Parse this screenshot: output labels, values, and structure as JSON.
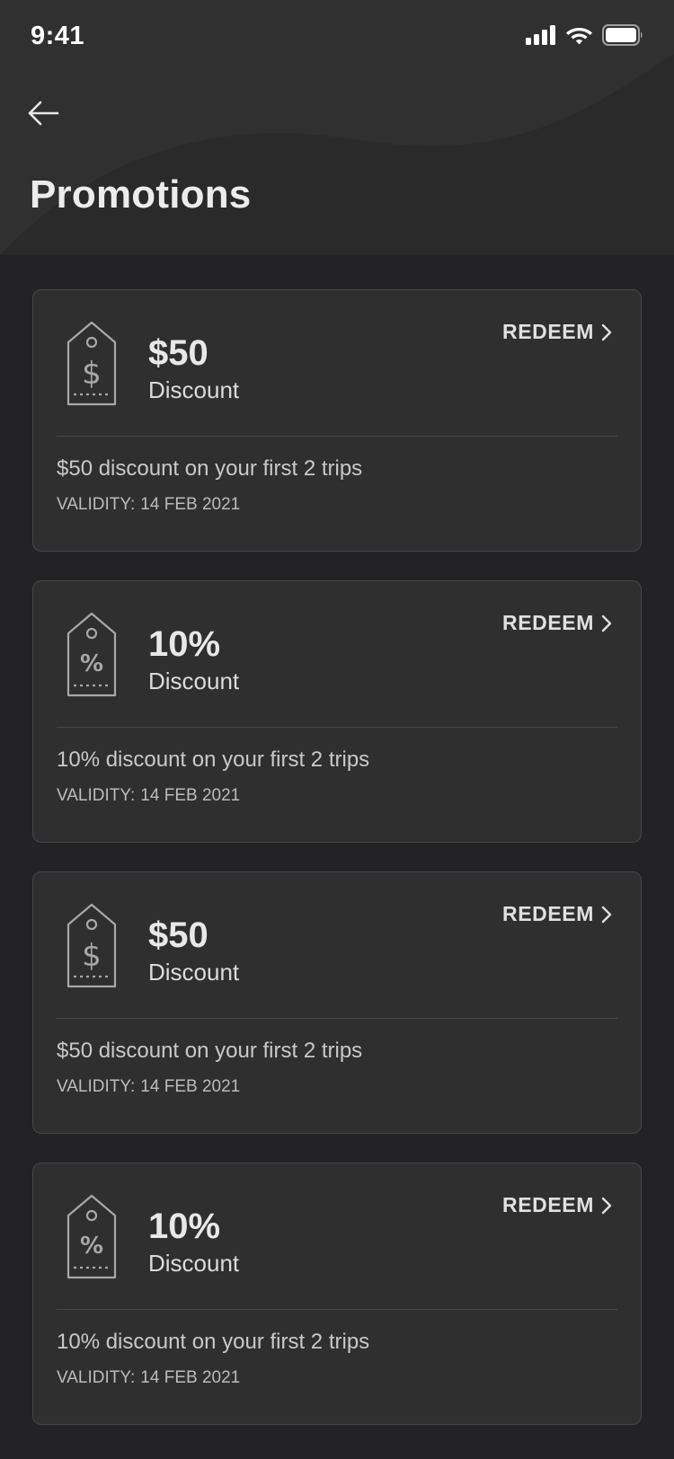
{
  "status_bar": {
    "time": "9:41",
    "icons": [
      "cellular-signal-icon",
      "wifi-icon",
      "battery-icon"
    ]
  },
  "header": {
    "back_icon": "arrow-left-icon",
    "title": "Promotions"
  },
  "colors": {
    "background": "#232325",
    "header": "#2c2c2d",
    "card": "#2f2f30",
    "card_border": "#474749",
    "text": "#e6e6e6"
  },
  "promotions": [
    {
      "icon": "price-tag-dollar-icon",
      "amount": "$50",
      "type": "Discount",
      "action": "REDEEM",
      "description": "$50 discount on your first 2 trips",
      "validity_label": "VALIDITY:",
      "validity_date": "14 FEB 2021"
    },
    {
      "icon": "price-tag-percent-icon",
      "amount": "10%",
      "type": "Discount",
      "action": "REDEEM",
      "description": "10% discount on your first 2 trips",
      "validity_label": "VALIDITY:",
      "validity_date": "14 FEB 2021"
    },
    {
      "icon": "price-tag-dollar-icon",
      "amount": "$50",
      "type": "Discount",
      "action": "REDEEM",
      "description": "$50 discount on your first 2 trips",
      "validity_label": "VALIDITY:",
      "validity_date": "14 FEB 2021"
    },
    {
      "icon": "price-tag-percent-icon",
      "amount": "10%",
      "type": "Discount",
      "action": "REDEEM",
      "description": "10% discount on your first 2 trips",
      "validity_label": "VALIDITY:",
      "validity_date": "14 FEB 2021"
    }
  ]
}
